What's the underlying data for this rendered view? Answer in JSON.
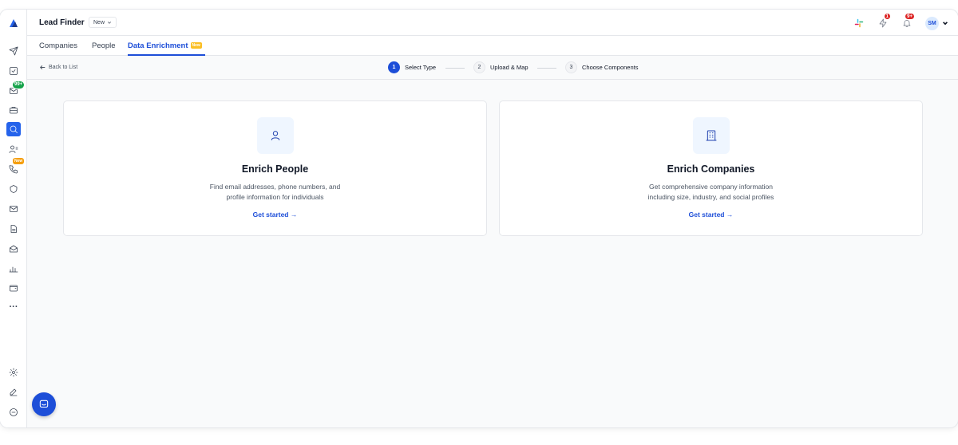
{
  "header": {
    "title": "Lead Finder",
    "new_select_label": "New",
    "notification_badge": "1",
    "bell_badge": "9+",
    "avatar_initials": "SM"
  },
  "sidebar": {
    "inbox_badge": "99+",
    "calls_badge": "New",
    "more_label": "···",
    "items": [
      "send-icon",
      "tasks-icon",
      "inbox-icon",
      "briefcase-icon",
      "search-icon",
      "contacts-icon",
      "phone-icon",
      "shield-icon",
      "mail-icon",
      "document-icon",
      "sequence-icon",
      "analytics-icon",
      "wallet-icon",
      "more-icon",
      "settings-icon",
      "edit-icon",
      "chat-icon"
    ]
  },
  "tabs": {
    "companies": "Companies",
    "people": "People",
    "data_enrichment": "Data Enrichment",
    "new_tag": "New"
  },
  "stepbar": {
    "back_label": "Back to List",
    "steps": [
      {
        "num": "1",
        "label": "Select Type"
      },
      {
        "num": "2",
        "label": "Upload & Map"
      },
      {
        "num": "3",
        "label": "Choose Components"
      }
    ]
  },
  "cards": [
    {
      "title": "Enrich People",
      "desc_line1": "Find email addresses, phone numbers, and",
      "desc_line2": "profile information for individuals",
      "cta": "Get started →"
    },
    {
      "title": "Enrich Companies",
      "desc_line1": "Get comprehensive company information",
      "desc_line2": "including size, industry, and social profiles",
      "cta": "Get started →"
    }
  ],
  "colors": {
    "accent": "#1d4ed8",
    "badge_green": "#16a34a",
    "badge_red": "#dc2626",
    "badge_new": "#f59e0b"
  }
}
